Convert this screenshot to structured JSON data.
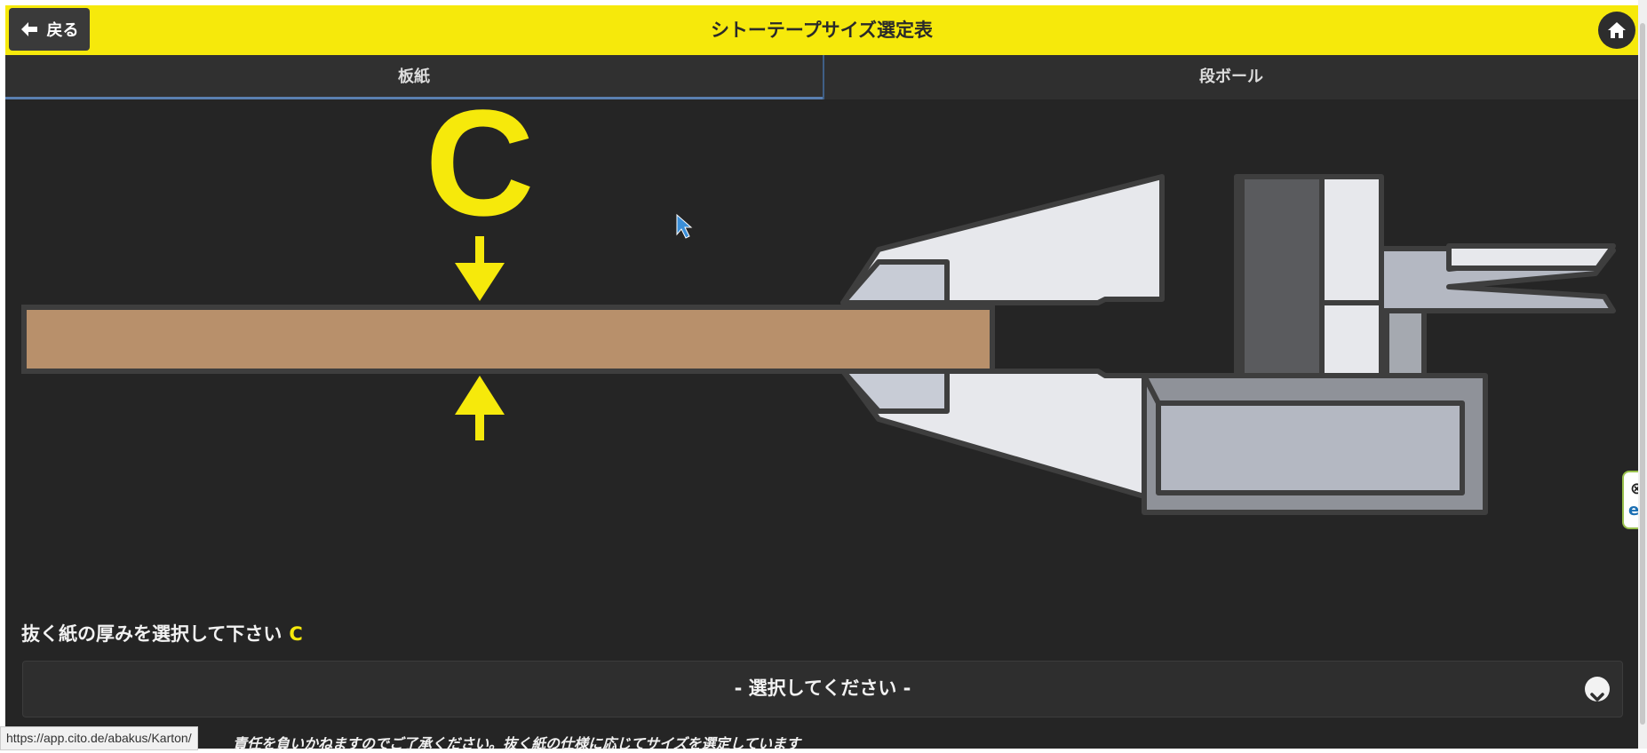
{
  "header": {
    "title": "シトーテープサイズ選定表",
    "back_label": "戻る"
  },
  "tabs": [
    {
      "label": "板紙",
      "active": true
    },
    {
      "label": "段ボール",
      "active": false
    }
  ],
  "figure": {
    "dimension_letter": "C"
  },
  "form": {
    "prompt": "抜く紙の厚みを選択して下さい",
    "prompt_accent": "C",
    "select_value": "- 選択してください -"
  },
  "disclaimer": "責任を負いかねますのでご了承ください。抜く紙の仕様に応じてサイズを選定しています",
  "status_bar": {
    "url": "https://app.cito.de/abakus/Karton/"
  },
  "colors": {
    "accent": "#f6e90b",
    "background": "#252525",
    "board": "#b8906b"
  }
}
